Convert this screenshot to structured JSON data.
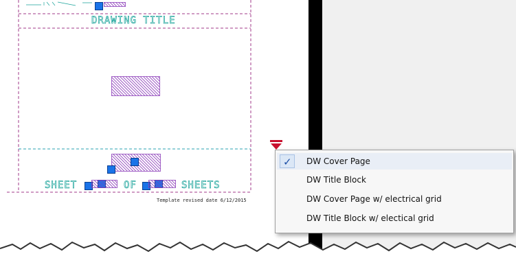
{
  "drawing": {
    "title_text": "DRAWING TITLE",
    "sheet_word": "SHEET",
    "of_word": "OF",
    "sheets_word": "SHEETS",
    "template_note": "Template revised date 6/12/2015"
  },
  "menu": {
    "items": [
      {
        "label": "DW Cover Page",
        "checked": true
      },
      {
        "label": "DW Title Block",
        "checked": false
      },
      {
        "label": "DW Cover Page w/ electrical grid",
        "checked": false
      },
      {
        "label": "DW Title Block w/ electical grid",
        "checked": false
      }
    ],
    "check_glyph": "✓"
  },
  "colors": {
    "sheet_bg": "#ffffff",
    "divider": "#000000",
    "viewport_bg": "#f0f0f0",
    "frame_dashed": "#a03a8a",
    "grid_dashed": "#2aa0b0",
    "cad_text_outline": "#1aa39a",
    "grip_fill": "#1a73e8",
    "trigger_red": "#c8102e"
  }
}
